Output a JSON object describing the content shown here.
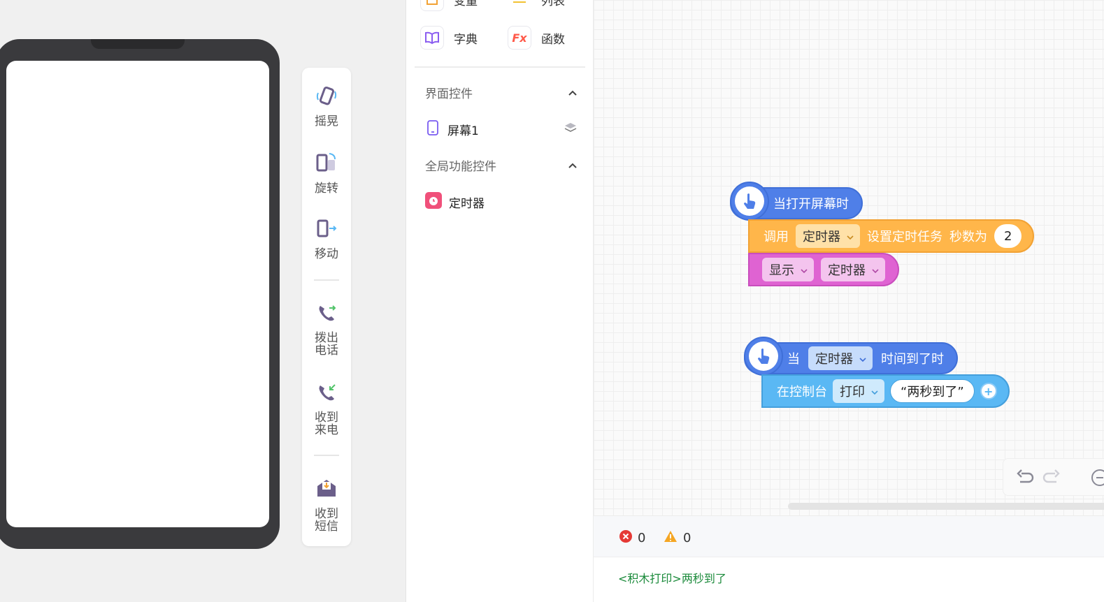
{
  "sensors": [
    {
      "label": "摇晃",
      "icon": "shake-phone-icon"
    },
    {
      "label": "旋转",
      "icon": "rotate-phone-icon"
    },
    {
      "label": "移动",
      "icon": "move-phone-icon"
    },
    {
      "label": "拨出电话",
      "icon": "outgoing-call-icon"
    },
    {
      "label": "收到来电",
      "icon": "incoming-call-icon"
    },
    {
      "label": "收到短信",
      "icon": "sms-received-icon"
    }
  ],
  "categories": {
    "variable": "变量",
    "list": "列表",
    "dict": "字典",
    "function": "函数",
    "fx_text": "Fx"
  },
  "sections": {
    "ui_controls": "界面控件",
    "screen_item": "屏幕1",
    "global_controls": "全局功能控件",
    "timer_item": "定时器"
  },
  "blocks": {
    "event1": "当打开屏幕时",
    "call": "调用",
    "timer": "定时器",
    "set_task": "设置定时任务",
    "seconds_label": "秒数为",
    "seconds_value": "2",
    "show": "显示",
    "when": "当",
    "time_up": "时间到了时",
    "console": "在控制台",
    "print": "打印",
    "message": "“两秒到了”",
    "plus": "+"
  },
  "console": {
    "errors": "0",
    "warnings": "0",
    "log": "<积木打印>两秒到了"
  },
  "colors": {
    "event": "#4f7fe8",
    "call_block": "#ffb64a",
    "show_block": "#df63d2",
    "console_block": "#5ab8f4",
    "log_text": "#1a8a3a"
  }
}
